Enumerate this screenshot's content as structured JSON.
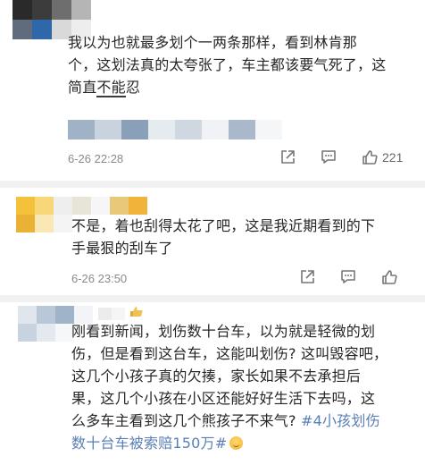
{
  "comments": [
    {
      "text_lines": [
        "我以为也就最多划个一两条那样，看到林肯那",
        "个，这划法真的太夸张了，车主都该要气死了，这",
        "简直"
      ],
      "text_underlined": "不能",
      "text_tail": "忍",
      "time": "6-26 22:28",
      "like_count": "221"
    },
    {
      "text_lines": [
        "不是，着也刮得太花了吧，这是我近期看到的下",
        "手最狠的刮车了"
      ],
      "time": "6-26 23:50",
      "like_count": ""
    },
    {
      "text_lines": [
        "刚看到新闻，划伤数十台车，以为就是轻微的划",
        "伤，但是看到这台车，这能叫划伤? 这叫毁容吧，",
        "这几个小孩子真的欠揍，家长如果不去承担后",
        "果，这几个小孩在小区还能好好生活下去吗，这",
        "么多车主看到这几个熊孩子不来气? "
      ],
      "hashtag_part1": "#4小孩划伤",
      "hashtag_part2": "数十台车被索赔150万#",
      "badge_icon": "hand-badge-icon"
    }
  ],
  "icons": {
    "share": "share-icon",
    "comment": "comment-icon",
    "like": "thumbs-up-icon"
  },
  "colors": {
    "hashtag": "#5a7fb5",
    "separator": "#f1f1f1",
    "meta_text": "#8a8a8a"
  }
}
